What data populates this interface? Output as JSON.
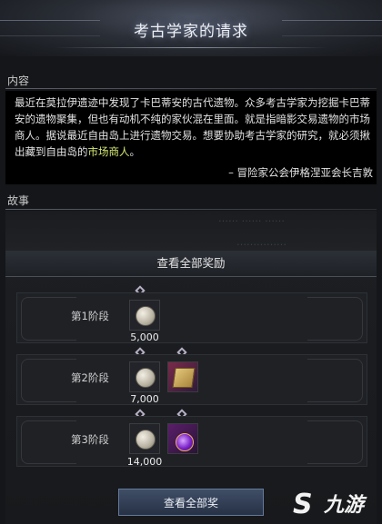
{
  "window": {
    "title": "考古学家的请求"
  },
  "content_section": {
    "label": "内容",
    "text_parts": [
      "最近在莫拉伊遗迹中发现了卡巴蒂安的古代遗物。众多考古学家为挖掘卡巴蒂安的遗物聚集，但也有动机不纯的家伙混在里面。就是指暗影交易遗物的市场商人。据说最近自由岛上进行遗物交易。想要协助考古学家的研究，就必须揪出藏到自由岛的",
      "市场商人",
      "。"
    ],
    "signature": "– 冒险家公会伊格涅亚会长吉敦"
  },
  "story_section": {
    "label": "故事",
    "ghost_line_1": "…… …… ……",
    "ghost_line_2": "……………"
  },
  "rewards": {
    "header": "查看全部奖励",
    "stages": [
      {
        "label": "第1阶段",
        "items": [
          {
            "icon": "silver-coin-icon",
            "amount": "5,000"
          }
        ]
      },
      {
        "label": "第2阶段",
        "items": [
          {
            "icon": "silver-coin-icon",
            "amount": "7,000"
          },
          {
            "icon": "treasure-map-icon"
          }
        ]
      },
      {
        "label": "第3阶段",
        "items": [
          {
            "icon": "silver-coin-icon",
            "amount": "14,000"
          },
          {
            "icon": "purple-orb-icon"
          }
        ]
      }
    ]
  },
  "footer": {
    "view_all_button": "查看全部奖"
  },
  "watermark": {
    "text": "九游",
    "logo_letter": "S"
  },
  "colors": {
    "highlight": "#d6e873",
    "button": "#3f4e66",
    "background": "#141619"
  }
}
